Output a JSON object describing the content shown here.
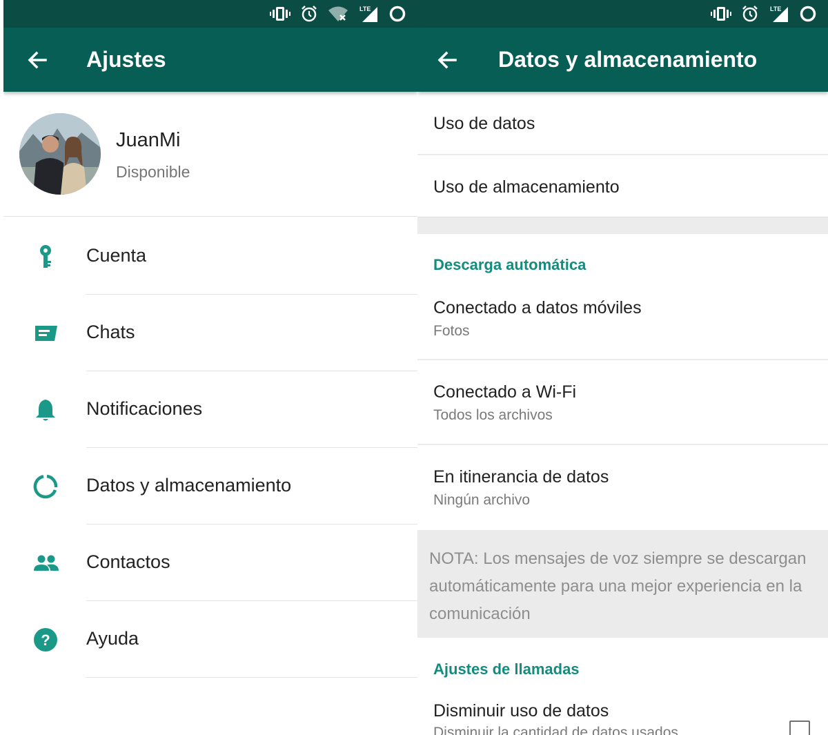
{
  "colors": {
    "status_bar": "#0b4d44",
    "app_bar": "#075e54",
    "accent": "#128c7e",
    "icon": "#1a9988"
  },
  "status_icons": [
    "vibrate-icon",
    "alarm-icon",
    "wifi-off-icon",
    "lte-signal-icon",
    "data-saver-icon"
  ],
  "status_text": {
    "lte": "LTE"
  },
  "left": {
    "title": "Ajustes",
    "profile": {
      "name": "JuanMi",
      "status": "Disponible"
    },
    "menu": [
      {
        "label": "Cuenta",
        "icon": "key-icon"
      },
      {
        "label": "Chats",
        "icon": "chat-icon"
      },
      {
        "label": "Notificaciones",
        "icon": "bell-icon"
      },
      {
        "label": "Datos y almacenamiento",
        "icon": "data-usage-icon"
      },
      {
        "label": "Contactos",
        "icon": "contacts-icon"
      },
      {
        "label": "Ayuda",
        "icon": "help-icon"
      }
    ]
  },
  "right": {
    "title": "Datos y almacenamiento",
    "items_top": [
      {
        "title": "Uso de datos"
      },
      {
        "title": "Uso de almacenamiento"
      }
    ],
    "section_auto": "Descarga automática",
    "auto_items": [
      {
        "title": "Conectado a datos móviles",
        "subtitle": "Fotos"
      },
      {
        "title": "Conectado a Wi-Fi",
        "subtitle": "Todos los archivos"
      },
      {
        "title": "En itinerancia de datos",
        "subtitle": "Ningún archivo"
      }
    ],
    "note": "NOTA: Los mensajes de voz siempre se descargan automáticamente para una mejor experiencia en la comunicación",
    "section_calls": "Ajustes de llamadas",
    "call_item": {
      "title": "Disminuir uso de datos",
      "subtitle": "Disminuir la cantidad de datos usados",
      "checked": false
    }
  }
}
